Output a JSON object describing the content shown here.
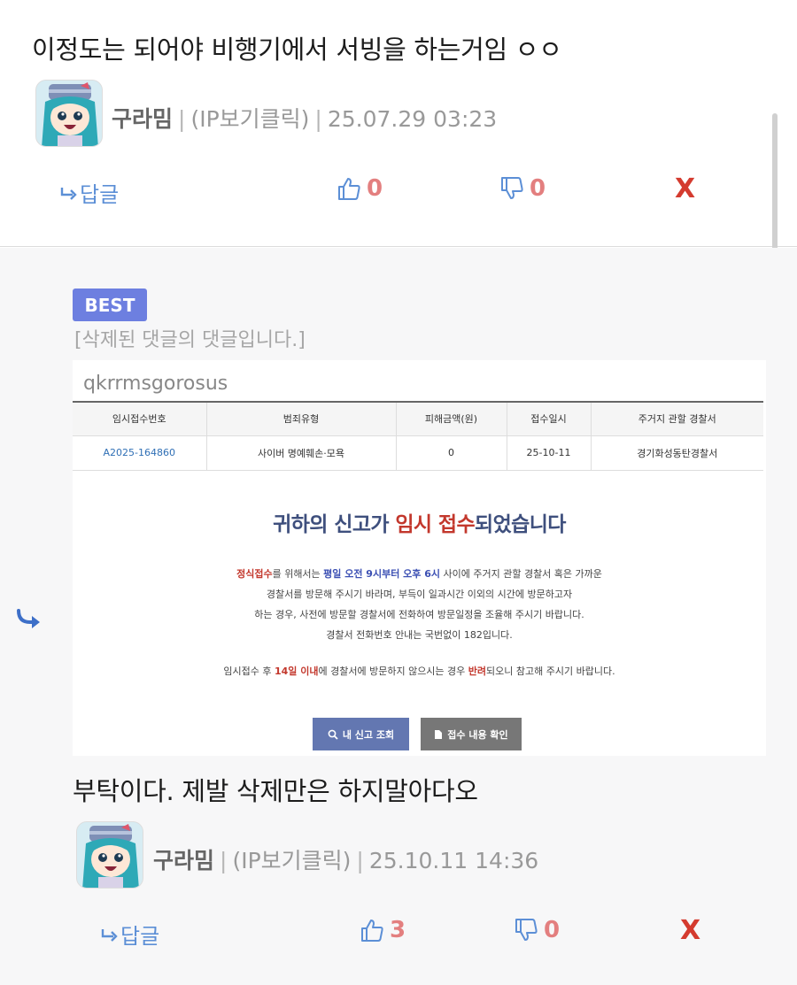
{
  "comment1": {
    "text": "이정도는 되어야 비행기에서 서빙을 하는거임 ㅇㅇ",
    "author": "구라밈",
    "ip_label": "(IP보기클릭)",
    "datetime": "25.07.29 03:23",
    "reply_label": "답글",
    "likes": "0",
    "dislikes": "0",
    "delete_label": "X"
  },
  "reply": {
    "badge": "BEST",
    "deleted_notice": "[삭제된 댓글의 댓글입니다.]",
    "screenshot": {
      "username": "qkrrmsgorosus",
      "table_headers": [
        "임시접수번호",
        "범죄유형",
        "피해금액(원)",
        "접수일시",
        "주거지 관할 경찰서"
      ],
      "table_row": [
        "A2025-164860",
        "사이버 명예훼손·모욕",
        "0",
        "25-10-11",
        "경기화성동탄경찰서"
      ],
      "title_part1": "귀하의 신고가 ",
      "title_highlight": "임시 접수",
      "title_part2": "되었습니다",
      "line1_red": "정식접수",
      "line1_a": "를 위해서는 ",
      "line1_blue": "평일 오전 9시부터 오후 6시",
      "line1_b": " 사이에 주거지 관할 경찰서 혹은 가까운",
      "line2": "경찰서를 방문해 주시기 바라며, 부득이 일과시간 이외의 시간에 방문하고자",
      "line3": "하는 경우, 사전에 방문할 경찰서에 전화하여 방문일정을 조율해 주시기 바랍니다.",
      "line4": "경찰서 전화번호 안내는 국번없이 182입니다.",
      "note_a": "임시접수 후 ",
      "note_red1": "14일 이내",
      "note_b": "에 경찰서에 방문하지 않으시는 경우 ",
      "note_red2": "반려",
      "note_c": "되오니 참고해 주시기 바랍니다.",
      "btn_search": "내 신고 조회",
      "btn_check": "접수 내용 확인"
    },
    "text": "부탁이다. 제발 삭제만은 하지말아다오",
    "author": "구라밈",
    "ip_label": "(IP보기클릭)",
    "datetime": "25.10.11 14:36",
    "reply_label": "답글",
    "likes": "3",
    "dislikes": "0",
    "delete_label": "X"
  },
  "colors": {
    "accent_blue": "#5c8fd6",
    "count_red": "#e37f7f",
    "delete_red": "#d43b2f",
    "best_badge": "#6d7fe0"
  },
  "icons": [
    "reply-arrow-icon",
    "thumbs-up-icon",
    "thumbs-down-icon",
    "nested-reply-arrow-icon",
    "search-icon",
    "document-icon"
  ]
}
